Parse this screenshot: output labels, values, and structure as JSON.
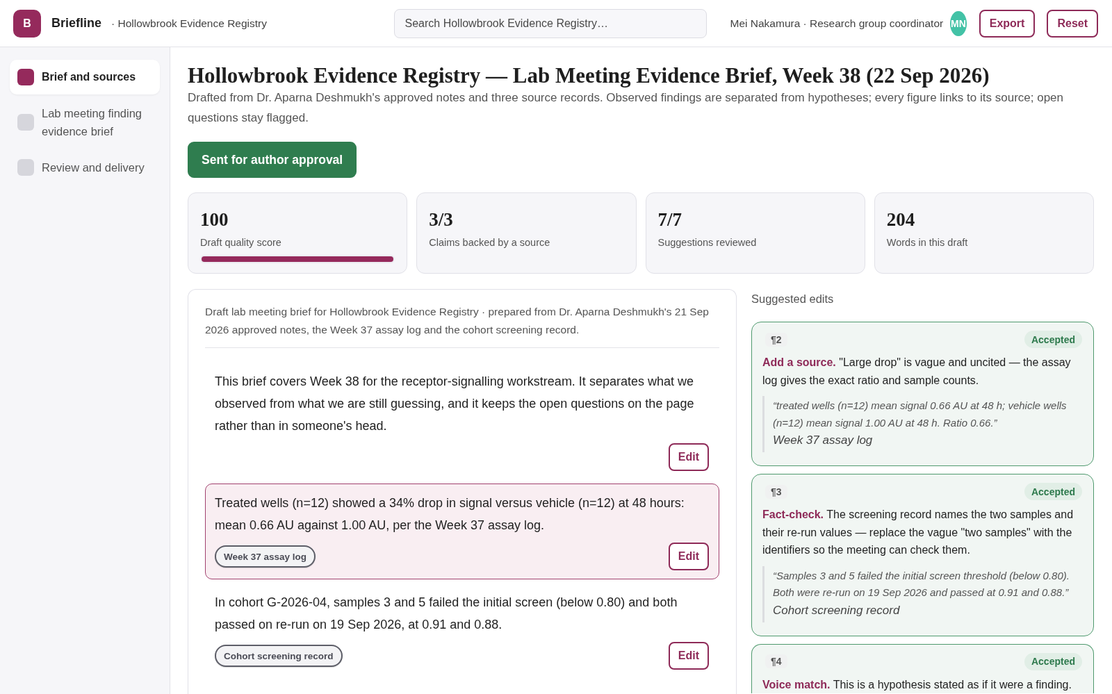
{
  "header": {
    "logo_letter": "B",
    "app_name": "Briefline",
    "breadcrumb": "· Hollowbrook Evidence Registry",
    "search": {
      "placeholder": "Search Hollowbrook Evidence Registry…"
    },
    "user": "Mei Nakamura · Research group coordinator",
    "avatar_initials": "MN",
    "buttons": [
      "Export",
      "Reset"
    ]
  },
  "sidebar": {
    "items": [
      {
        "label": "Brief and sources",
        "selected": true
      },
      {
        "label": "Lab meeting finding evidence brief",
        "selected": false
      },
      {
        "label": "Review and delivery",
        "selected": false
      }
    ]
  },
  "page": {
    "title": "Hollowbrook Evidence Registry — Lab Meeting Evidence Brief, Week 38 (22 Sep 2026)",
    "subtitle": "Drafted from Dr. Aparna Deshmukh's approved notes and three source records. Observed findings are separated from hypotheses; every figure links to its source; open questions stay flagged.",
    "status_button": "Sent for author approval"
  },
  "stats": [
    {
      "value": "100",
      "label": "Draft quality score",
      "level": 1
    },
    {
      "value": "3/3",
      "label": "Claims backed by a source"
    },
    {
      "value": "7/7",
      "label": "Suggestions reviewed"
    },
    {
      "value": "204",
      "label": "Words in this draft"
    }
  ],
  "draft": {
    "intro": "Draft lab meeting brief for Hollowbrook Evidence Registry · prepared from Dr. Aparna Deshmukh's 21 Sep 2026 approved notes, the Week 37 assay log and the cohort screening record.",
    "paragraphs": [
      {
        "text": "This brief covers Week 38 for the receptor-signalling workstream. It separates what we observed from what we are still guessing, and it keeps the open questions on the page rather than in someone's head.",
        "selected": false,
        "edit_button": "Edit"
      },
      {
        "text": "Treated wells (n=12) showed a 34% drop in signal versus vehicle (n=12) at 48 hours: mean 0.66 AU against 1.00 AU, per the Week 37 assay log.",
        "selected": true,
        "source": "Week 37 assay log",
        "edit_button": "Edit"
      },
      {
        "text": "In cohort G-2026-04, samples 3 and 5 failed the initial screen (below 0.80) and both passed on re-run on 19 Sep 2026, at 0.91 and 0.88.",
        "selected": false,
        "source": "Cohort screening record",
        "edit_button": "Edit"
      }
    ]
  },
  "suggestions": {
    "heading": "Suggested edits",
    "items": [
      {
        "paragraph": "¶2",
        "status": "Accepted",
        "text": "**Add a source.** \"Large drop\" is vague and uncited — the assay log gives the exact ratio and sample counts.",
        "quote": "“treated wells (n=12) mean signal 0.66 AU at 48 h; vehicle wells (n=12) mean signal 1.00 AU at 48 h. Ratio 0.66.”",
        "source": "Week 37 assay log"
      },
      {
        "paragraph": "¶3",
        "status": "Accepted",
        "text": "**Fact-check.** The screening record names the two samples and their re-run values — replace the vague \"two samples\" with the identifiers so the meeting can check them.",
        "quote": "“Samples 3 and 5 failed the initial screen threshold (below 0.80). Both were re-run on 19 Sep 2026 and passed at 0.91 and 0.88.”",
        "source": "Cohort screening record"
      },
      {
        "paragraph": "¶4",
        "status": "Accepted",
        "text": "**Voice match.** This is a hypothesis stated as if it were a finding."
      }
    ]
  }
}
